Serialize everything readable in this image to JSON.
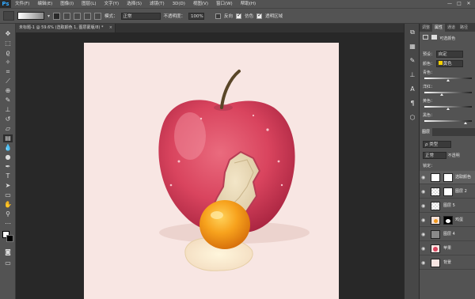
{
  "app": {
    "logo": "Ps"
  },
  "menu": [
    "文件(F)",
    "编辑(E)",
    "图像(I)",
    "图层(L)",
    "文字(Y)",
    "选择(S)",
    "滤镜(T)",
    "3D(D)",
    "视图(V)",
    "窗口(W)",
    "帮助(H)"
  ],
  "window_controls": [
    "—",
    "□",
    "✕"
  ],
  "options": {
    "mode_label": "模式：",
    "mode_value": "正常",
    "opacity_label": "不透明度：",
    "opacity_value": "100%",
    "reverse_label": "反向",
    "dither_label": "仿色",
    "transparency_label": "透明区域"
  },
  "document_tab": {
    "title": "未标题-1 @ 59.6% (选取颜色 1, 图层蒙版/8) *",
    "close": "×"
  },
  "right_tabs": [
    "调整",
    "属性",
    "通道",
    "路径"
  ],
  "properties": {
    "title": "可选颜色",
    "preset_label": "预设：",
    "preset_value": "自定",
    "colors_label": "颜色：",
    "colors_value": "黄色",
    "cyan_label": "青色：",
    "magenta_label": "洋红：",
    "yellow_label": "黄色：",
    "black_label": "黑色："
  },
  "layers_panel": {
    "tab": "图层",
    "kind_label": "ρ 类型",
    "blend_value": "正常",
    "opacity_label": "不透明",
    "lock_label": "锁定：",
    "layers": [
      {
        "name": "选取颜色",
        "thumb": "adjust"
      },
      {
        "name": "图层 2",
        "thumb": "checker"
      },
      {
        "name": "图层 5",
        "thumb": "checker"
      },
      {
        "name": "鸡蛋",
        "thumb": "egg"
      },
      {
        "name": "图层 4",
        "thumb": "dark"
      },
      {
        "name": "苹果",
        "thumb": "apple"
      },
      {
        "name": "背景",
        "thumb": "bg"
      }
    ]
  },
  "colors": {
    "ui_bg": "#535353",
    "canvas_bg": "#f8e6e3",
    "apple_red": "#d9445e",
    "yolk": "#f39a1d"
  }
}
